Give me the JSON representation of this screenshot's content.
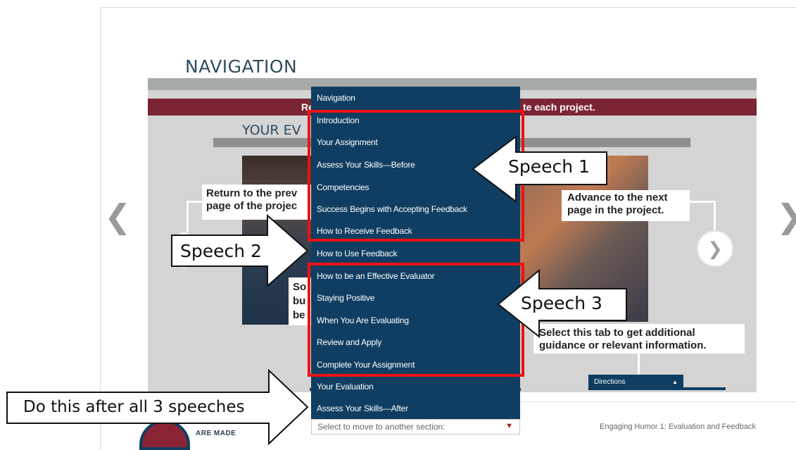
{
  "page": {
    "title": "NAVIGATION",
    "banner_left": "Re",
    "banner_right": "te each project.",
    "section_heading": "YOUR EV",
    "footer_text": "Engaging Humor 1: Evaluation and Feedback",
    "logo_text": "ARE MADE"
  },
  "callouts": {
    "prev": "Return to the prev\npage of the projec",
    "next": "Advance to the next\npage in the project.",
    "tab": "Select this tab to get additional\nguidance or relevant information.",
    "so": "So\nbu\nbe"
  },
  "nav_glyphs": {
    "left": "❮",
    "right": "❯",
    "next_circle": "❯"
  },
  "directions_tab": {
    "label": "Directions",
    "arrow": "▲"
  },
  "dropdown": {
    "items": [
      "Navigation",
      "Introduction",
      "Your Assignment",
      "Assess Your Skills—Before",
      "Competencies",
      "Success Begins with Accepting Feedback",
      "How to Receive Feedback",
      "How to Use Feedback",
      "How to be an Effective Evaluator",
      "Staying Positive",
      "When You Are Evaluating",
      "Review and Apply",
      "Complete Your Assignment",
      "Your Evaluation",
      "Assess Your Skills—After"
    ],
    "select_placeholder": "Select to move to another section:",
    "select_caret": "▼"
  },
  "annotations": {
    "speech1": "Speech 1",
    "speech2": "Speech 2",
    "speech3": "Speech 3",
    "after": "Do this after all 3 speeches"
  },
  "colors": {
    "dropdown_bg": "#0f3e62",
    "banner": "#7a2434",
    "highlight_box": "#ee1111"
  }
}
